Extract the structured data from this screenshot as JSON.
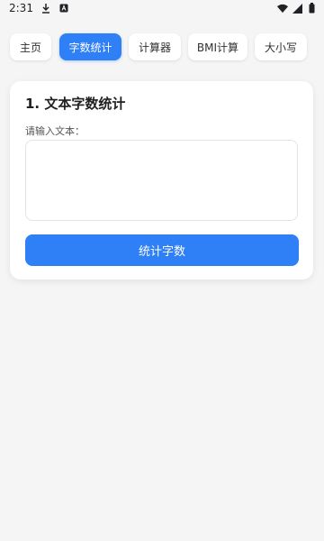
{
  "status_bar": {
    "time": "2:31"
  },
  "tabs": [
    {
      "label": "主页",
      "active": false
    },
    {
      "label": "字数统计",
      "active": true
    },
    {
      "label": "计算器",
      "active": false
    },
    {
      "label": "BMI计算",
      "active": false
    },
    {
      "label": "大小写",
      "active": false
    }
  ],
  "card": {
    "title": "1. 文本字数统计",
    "input_label": "请输入文本：",
    "textarea_value": "",
    "button_label": "统计字数"
  },
  "colors": {
    "accent": "#2f7ff6",
    "background": "#f5f5f5",
    "card": "#ffffff"
  }
}
